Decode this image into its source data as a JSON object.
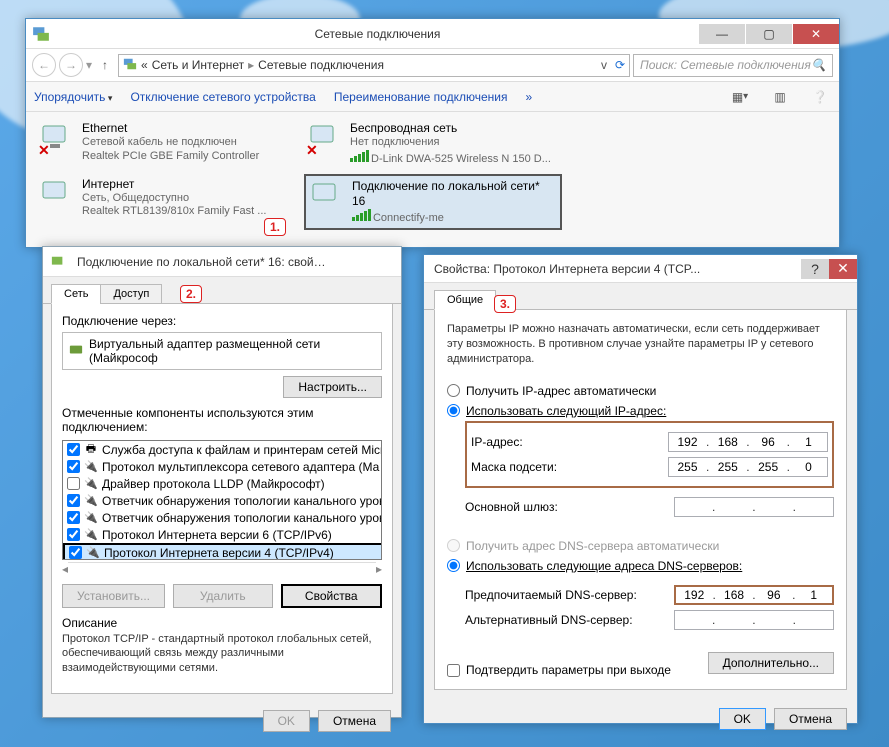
{
  "explorer": {
    "title": "Сетевые подключения",
    "breadcrumb": {
      "root_left": "«",
      "part1": "Сеть и Интернет",
      "part2": "Сетевые подключения"
    },
    "search_placeholder": "Поиск: Сетевые подключения",
    "cmdbar": {
      "organize": "Упорядочить",
      "disable": "Отключение сетевого устройства",
      "rename": "Переименование подключения",
      "overflow": "»"
    },
    "connections": [
      {
        "name": "Ethernet",
        "status": "Сетевой кабель не подключен",
        "device": "Realtek PCIe GBE Family Controller",
        "x": true
      },
      {
        "name": "Беспроводная сеть",
        "status": "Нет подключения",
        "device": "D-Link DWA-525 Wireless N 150 D...",
        "x": true
      },
      {
        "name": "Интернет",
        "status": "Сеть, Общедоступно",
        "device": "Realtek RTL8139/810x Family Fast ...",
        "x": false
      },
      {
        "name": "Подключение по локальной сети* 16",
        "status": "",
        "device": "Connectify-me",
        "selected": true
      }
    ]
  },
  "props": {
    "title": "Подключение по локальной сети* 16: свой…",
    "tabs": {
      "network": "Сеть",
      "access": "Доступ"
    },
    "connect_via_label": "Подключение через:",
    "adapter": "Виртуальный адаптер размещенной сети (Майкрософ",
    "configure": "Настроить...",
    "components_label": "Отмеченные компоненты используются этим подключением:",
    "components": [
      {
        "checked": true,
        "label": "Служба доступа к файлам и принтерам сетей Micro"
      },
      {
        "checked": true,
        "label": "Протокол мультиплексора сетевого адаптера (Ма"
      },
      {
        "checked": false,
        "label": "Драйвер протокола LLDP (Майкрософт)"
      },
      {
        "checked": true,
        "label": "Ответчик обнаружения топологии канального уров"
      },
      {
        "checked": true,
        "label": "Ответчик обнаружения топологии канального уров"
      },
      {
        "checked": true,
        "label": "Протокол Интернета версии 6 (TCP/IPv6)"
      },
      {
        "checked": true,
        "label": "Протокол Интернета версии 4 (TCP/IPv4)",
        "selected": true
      }
    ],
    "buttons": {
      "install": "Установить...",
      "uninstall": "Удалить",
      "properties": "Свойства"
    },
    "desc_title": "Описание",
    "desc_text": "Протокол TCP/IP - стандартный протокол глобальных сетей, обеспечивающий связь между различными взаимодействующими сетями.",
    "ok": "OK",
    "cancel": "Отмена"
  },
  "ipv4": {
    "title": "Свойства: Протокол Интернета версии 4 (TCP...",
    "tab_general": "Общие",
    "info": "Параметры IP можно назначать автоматически, если сеть поддерживает эту возможность. В противном случае узнайте параметры IP у сетевого администратора.",
    "radio_ip_auto": "Получить IP-адрес автоматически",
    "radio_ip_manual": "Использовать следующий IP-адрес:",
    "lbl_ip": "IP-адрес:",
    "lbl_mask": "Маска подсети:",
    "lbl_gw": "Основной шлюз:",
    "ip_address": [
      "192",
      "168",
      "96",
      "1"
    ],
    "mask": [
      "255",
      "255",
      "255",
      "0"
    ],
    "gateway": [
      "",
      "",
      "",
      ""
    ],
    "radio_dns_auto": "Получить адрес DNS-сервера автоматически",
    "radio_dns_manual": "Использовать следующие адреса DNS-серверов:",
    "lbl_dns1": "Предпочитаемый DNS-сервер:",
    "lbl_dns2": "Альтернативный DNS-сервер:",
    "dns1": [
      "192",
      "168",
      "96",
      "1"
    ],
    "dns2": [
      "",
      "",
      "",
      ""
    ],
    "confirm_exit": "Подтвердить параметры при выходе",
    "advanced": "Дополнительно...",
    "ok": "OK",
    "cancel": "Отмена"
  },
  "callouts": {
    "c1": "1.",
    "c2": "2.",
    "c3": "3."
  }
}
